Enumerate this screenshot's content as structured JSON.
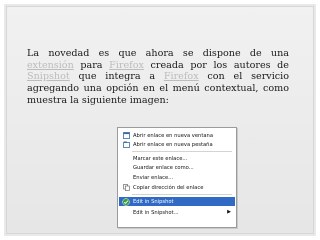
{
  "paragraph": {
    "part1": "La novedad es que ahora se dispone de una ",
    "link1": "extensión",
    "part2": " para ",
    "link2": "Firefox",
    "part3": " creada por los autores de ",
    "link3": "Snipshot",
    "part4": " que integra a ",
    "link4": "Firefox",
    "part5": " con el servicio agregando una opción en el menú contextual, como muestra la siguiente imagen:"
  },
  "context_menu": {
    "items": [
      {
        "label": "Abrir enlace en nueva ventana",
        "icon": "window-icon"
      },
      {
        "label": "Abrir enlace en nueva pestaña",
        "icon": "tab-icon"
      },
      {
        "label": "Marcar este enlace...",
        "icon": "none"
      },
      {
        "label": "Guardar enlace como...",
        "icon": "none"
      },
      {
        "label": "Enviar enlace...",
        "icon": "none"
      },
      {
        "label": "Copiar dirección del enlace",
        "icon": "copy-icon"
      },
      {
        "label": "Edit in Snipshot",
        "icon": "snipshot-icon",
        "highlighted": true
      },
      {
        "label": "Edit in Snipshot...",
        "icon": "none",
        "submenu": true
      }
    ]
  },
  "colors": {
    "link": "#bcbcbc",
    "highlight": "#316ac5",
    "slide_background": "#e6e6e6"
  }
}
